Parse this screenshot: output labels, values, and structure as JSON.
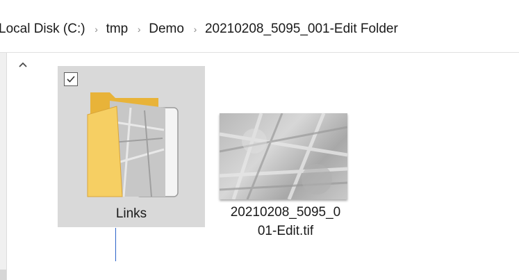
{
  "breadcrumb": {
    "items": [
      "Local Disk (C:)",
      "tmp",
      "Demo",
      "20210208_5095_001-Edit Folder"
    ],
    "separator": "›"
  },
  "files": [
    {
      "label": "Links",
      "type": "folder",
      "selected": true,
      "checked": true,
      "icon": "folder-icon"
    },
    {
      "label_line1": "20210208_5095_0",
      "label_line2": "01-Edit.tif",
      "type": "image",
      "icon": "image-thumbnail"
    }
  ],
  "colors": {
    "selection": "#d9d9d9",
    "folder_yellow": "#f5c84c",
    "drag_line": "#2b62c9"
  }
}
